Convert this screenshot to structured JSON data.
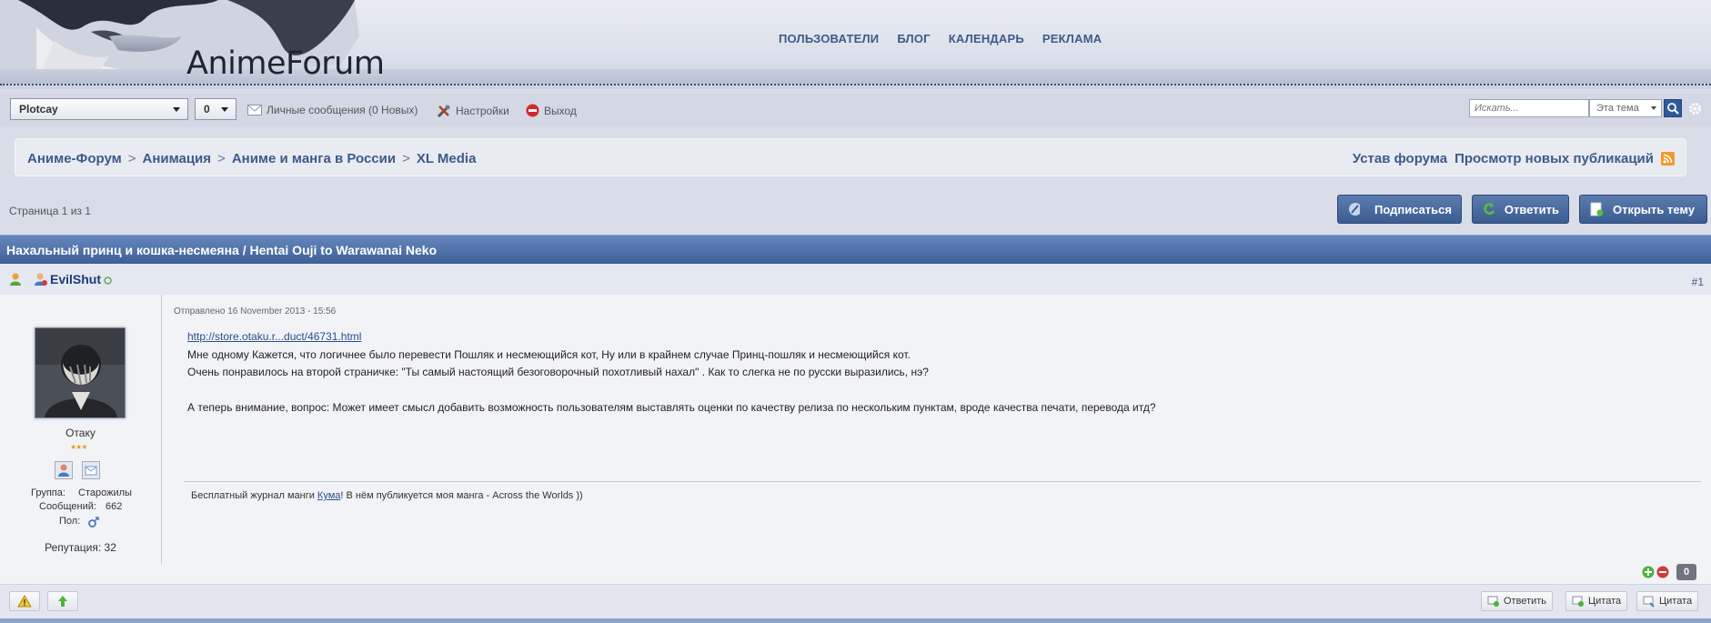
{
  "header": {
    "logo_text": "AnimeForum",
    "nav": [
      "ПОЛЬЗОВАТЕЛИ",
      "БЛОГ",
      "КАЛЕНДАРЬ",
      "РЕКЛАМА"
    ]
  },
  "toolbar": {
    "user_select": "Plotcay",
    "count_select": "0",
    "messages": "Личные сообщения (0 Новых)",
    "settings": "Настройки",
    "logout": "Выход",
    "search_placeholder": "Искать...",
    "search_scope": "Эта тема"
  },
  "breadcrumb": {
    "items": [
      "Аниме-Форум",
      "Анимация",
      "Аниме и манга в России",
      "XL Media"
    ],
    "separator": ">",
    "right_links": [
      "Устав форума",
      "Просмотр новых публикаций"
    ]
  },
  "pagination": {
    "text": "Страница 1 из 1"
  },
  "actions": {
    "subscribe": "Подписаться",
    "reply": "Ответить",
    "new_topic": "Открыть тему"
  },
  "topic": {
    "title": "Нахальный принц и кошка-несмеяна / Hentai Ouji to Warawanai Neko"
  },
  "post": {
    "author": "EvilShut",
    "number": "#1",
    "date": "Отправлено 16 November 2013 - 15:56",
    "link": "http://store.otaku.r...duct/46731.html",
    "lines": [
      "Мне одному Кажется, что логичнее было перевести Пошляк и несмеющийся кот, Ну или в крайнем случае Принц-пошляк и несмеющийся кот.",
      "Очень понравилось на второй страничке: \"Ты самый настоящий безоговорочный похотливый нахал\" . Как то слегка не по русски выразились, нэ?",
      "А теперь внимание, вопрос: Может имеет смысл добавить возможность пользователям выставлять оценки по качеству релиза по нескольким пунктам, вроде качества печати, перевода итд?"
    ],
    "sig_prefix": "Бесплатный журнал манги ",
    "sig_link": "Кума",
    "sig_suffix": "! В нём публикуется моя манга - Across the Worlds ))",
    "rating": "0"
  },
  "user_info": {
    "title": "Отаку",
    "group_label": "Группа:",
    "group_value": "Старожилы",
    "posts_label": "Сообщений:",
    "posts_value": "662",
    "gender_label": "Пол:",
    "reputation": "Репутация: 32"
  },
  "footer": {
    "reply": "Ответить",
    "quote1": "Цитата",
    "quote2": "Цитата"
  },
  "colors": {
    "topic_bar": "#4a6ca4",
    "link": "#3d5a8a"
  }
}
